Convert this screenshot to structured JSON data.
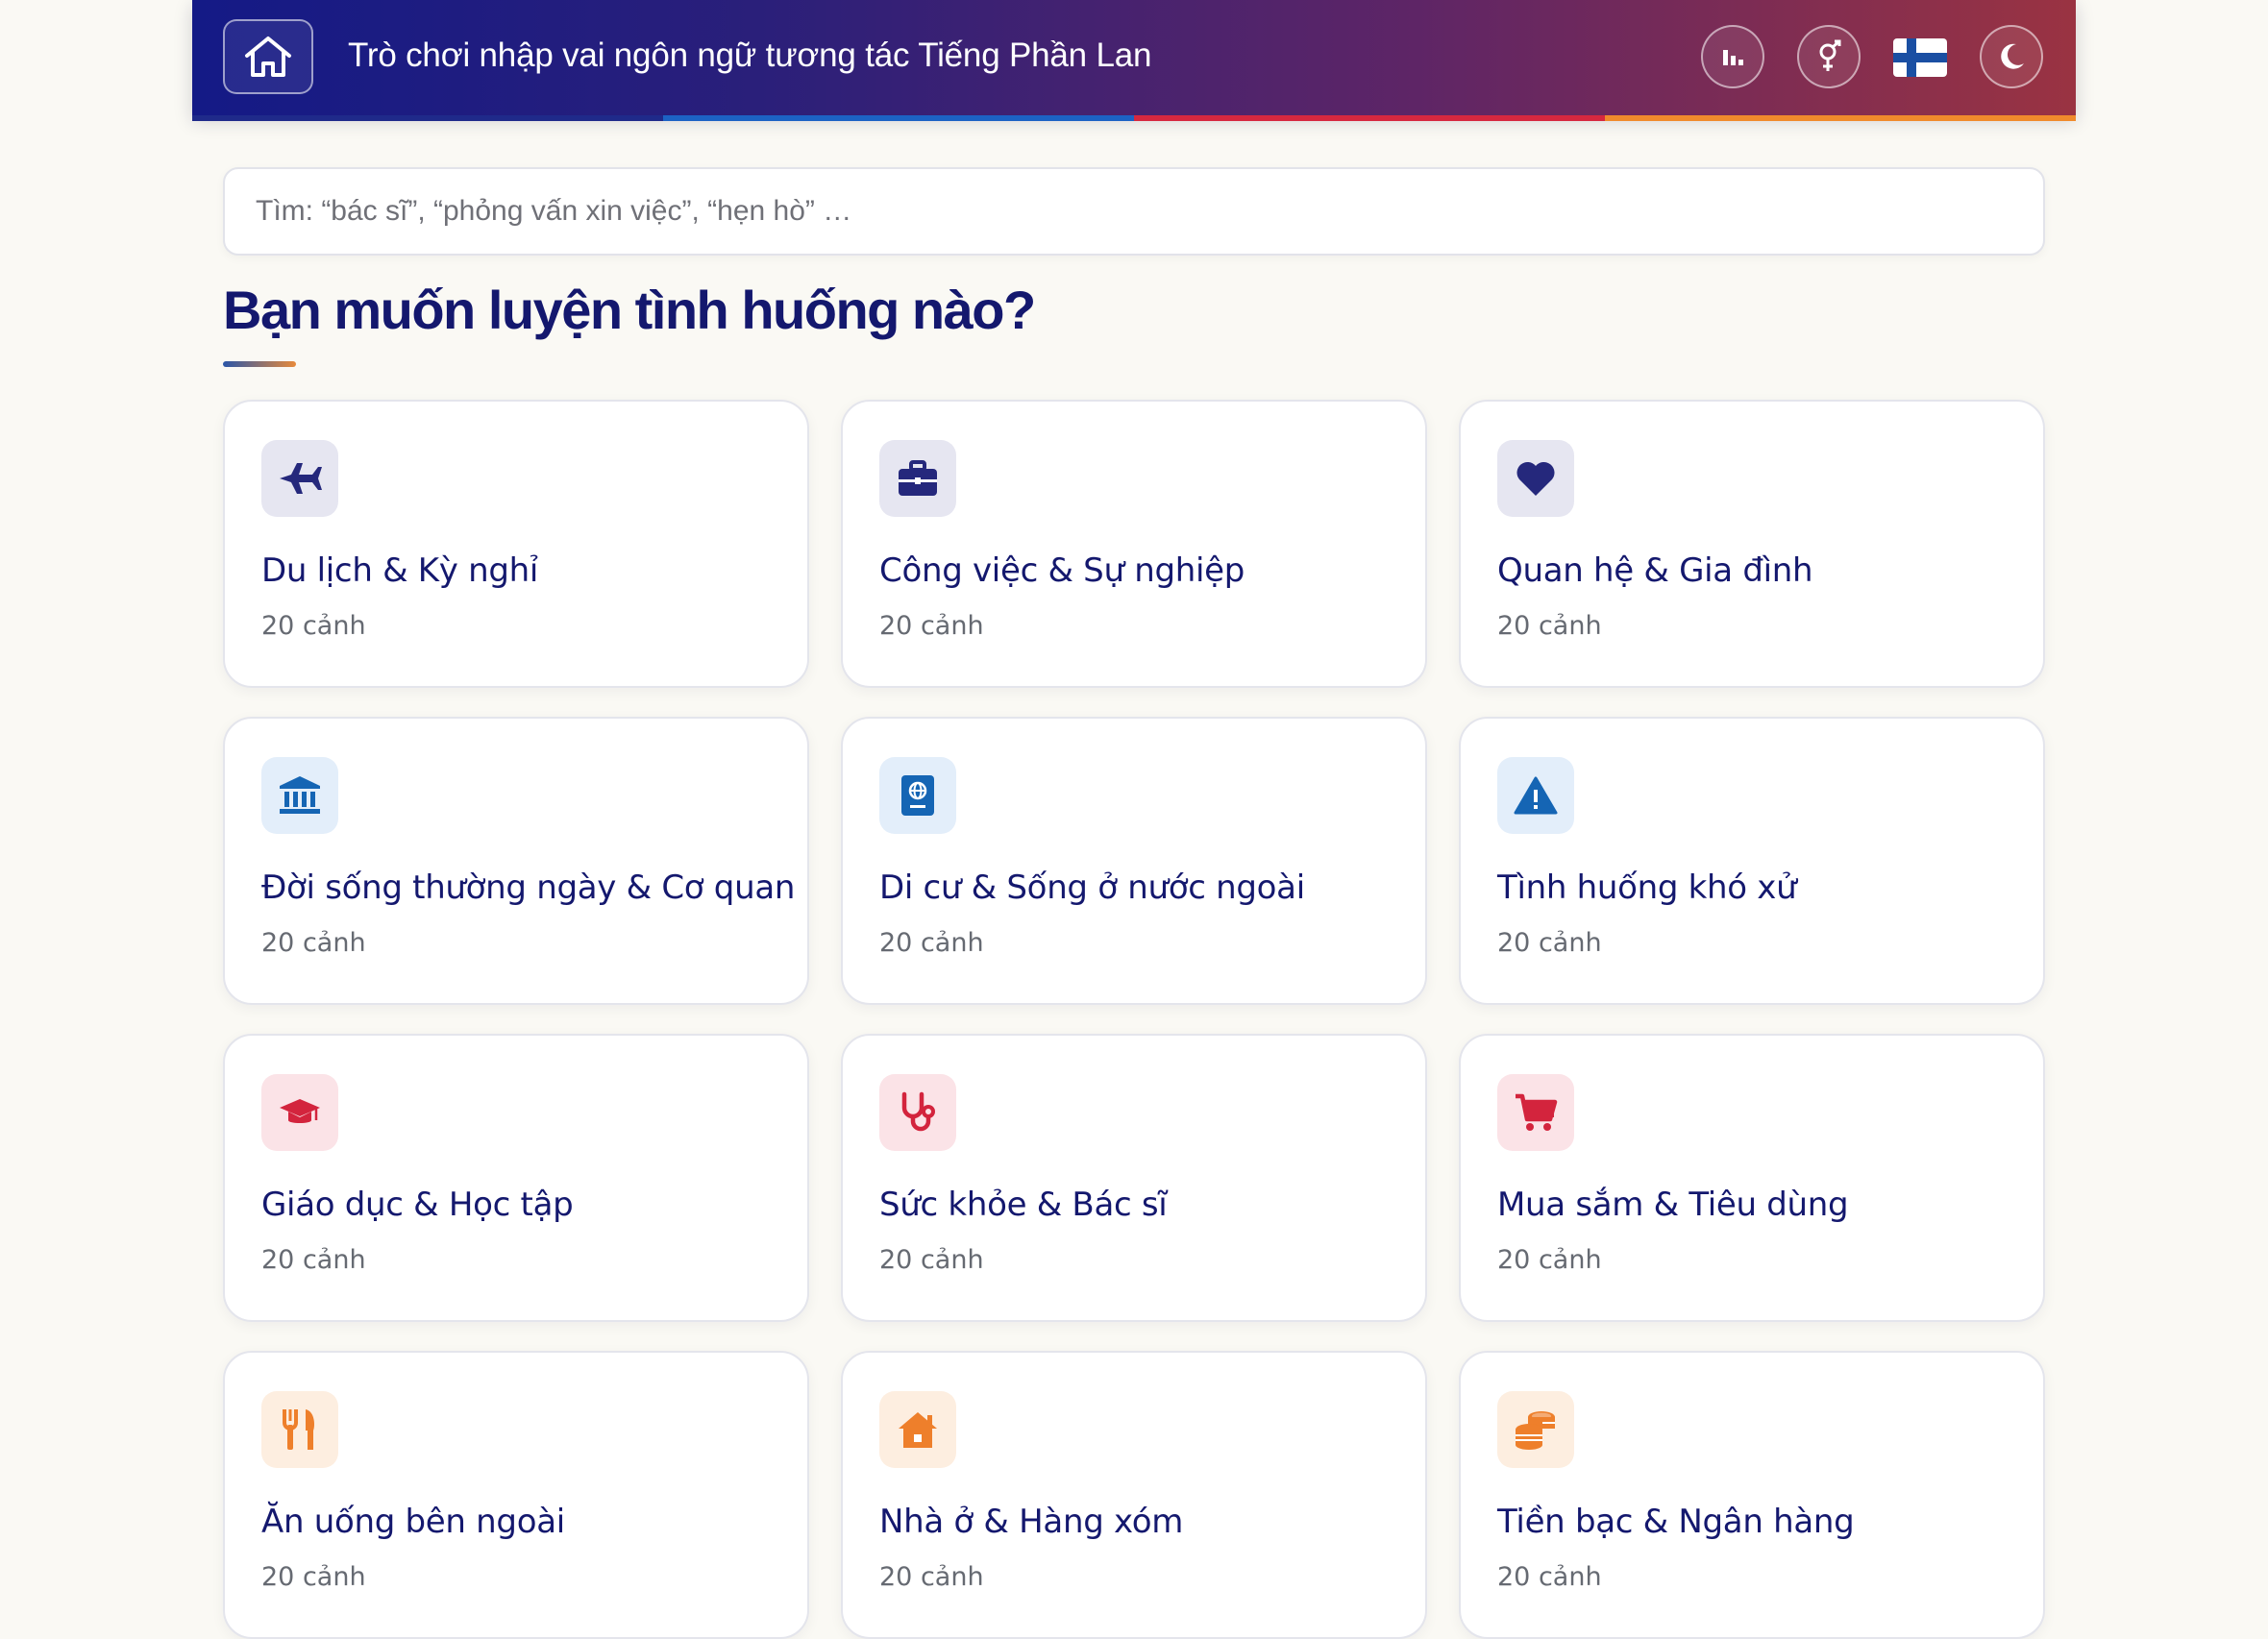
{
  "header": {
    "title": "Trò chơi nhập vai ngôn ngữ tương tác Tiếng Phần Lan",
    "home_icon": "home-icon",
    "actions": [
      {
        "name": "stats-button",
        "icon": "bar-chart-icon"
      },
      {
        "name": "gender-button",
        "icon": "gender-icon"
      },
      {
        "name": "language-flag",
        "icon": "finland-flag-icon"
      },
      {
        "name": "dark-mode-button",
        "icon": "moon-icon"
      }
    ],
    "stripe_colors": [
      "#1f2a8a",
      "#1c62c4",
      "#d6283f",
      "#f08a2c"
    ]
  },
  "search": {
    "placeholder": "Tìm: “bác sĩ”, “phỏng vấn xin việc”, “hẹn hò” …",
    "value": ""
  },
  "heading": "Bạn muốn luyện tình huống nào?",
  "categories": [
    {
      "title": "Du lịch & Kỳ nghỉ",
      "count": "20 cảnh",
      "icon": "airplane-icon",
      "bg": "#e6e6f1",
      "fg": "#25287c"
    },
    {
      "title": "Công việc & Sự nghiệp",
      "count": "20 cảnh",
      "icon": "briefcase-icon",
      "bg": "#e6e6f1",
      "fg": "#25287c"
    },
    {
      "title": "Quan hệ & Gia đình",
      "count": "20 cảnh",
      "icon": "heart-icon",
      "bg": "#e6e6f1",
      "fg": "#25287c"
    },
    {
      "title": "Đời sống thường ngày & Cơ quan",
      "count": "20 cảnh",
      "icon": "bank-icon",
      "bg": "#e3eefa",
      "fg": "#1565b4"
    },
    {
      "title": "Di cư & Sống ở nước ngoài",
      "count": "20 cảnh",
      "icon": "passport-icon",
      "bg": "#e3eefa",
      "fg": "#1565b4"
    },
    {
      "title": "Tình huống khó xử",
      "count": "20 cảnh",
      "icon": "warning-icon",
      "bg": "#e3eefa",
      "fg": "#1565b4"
    },
    {
      "title": "Giáo dục & Học tập",
      "count": "20 cảnh",
      "icon": "graduation-cap-icon",
      "bg": "#fbe3e7",
      "fg": "#d3243d"
    },
    {
      "title": "Sức khỏe & Bác sĩ",
      "count": "20 cảnh",
      "icon": "stethoscope-icon",
      "bg": "#fbe3e7",
      "fg": "#d3243d"
    },
    {
      "title": "Mua sắm & Tiêu dùng",
      "count": "20 cảnh",
      "icon": "shopping-cart-icon",
      "bg": "#fbe3e7",
      "fg": "#d3243d"
    },
    {
      "title": "Ăn uống bên ngoài",
      "count": "20 cảnh",
      "icon": "utensils-icon",
      "bg": "#fdeee0",
      "fg": "#ee7f2b"
    },
    {
      "title": "Nhà ở & Hàng xóm",
      "count": "20 cảnh",
      "icon": "house-icon",
      "bg": "#fdeee0",
      "fg": "#ee7f2b"
    },
    {
      "title": "Tiền bạc & Ngân hàng",
      "count": "20 cảnh",
      "icon": "coins-icon",
      "bg": "#fdeee0",
      "fg": "#ee7f2b"
    }
  ]
}
